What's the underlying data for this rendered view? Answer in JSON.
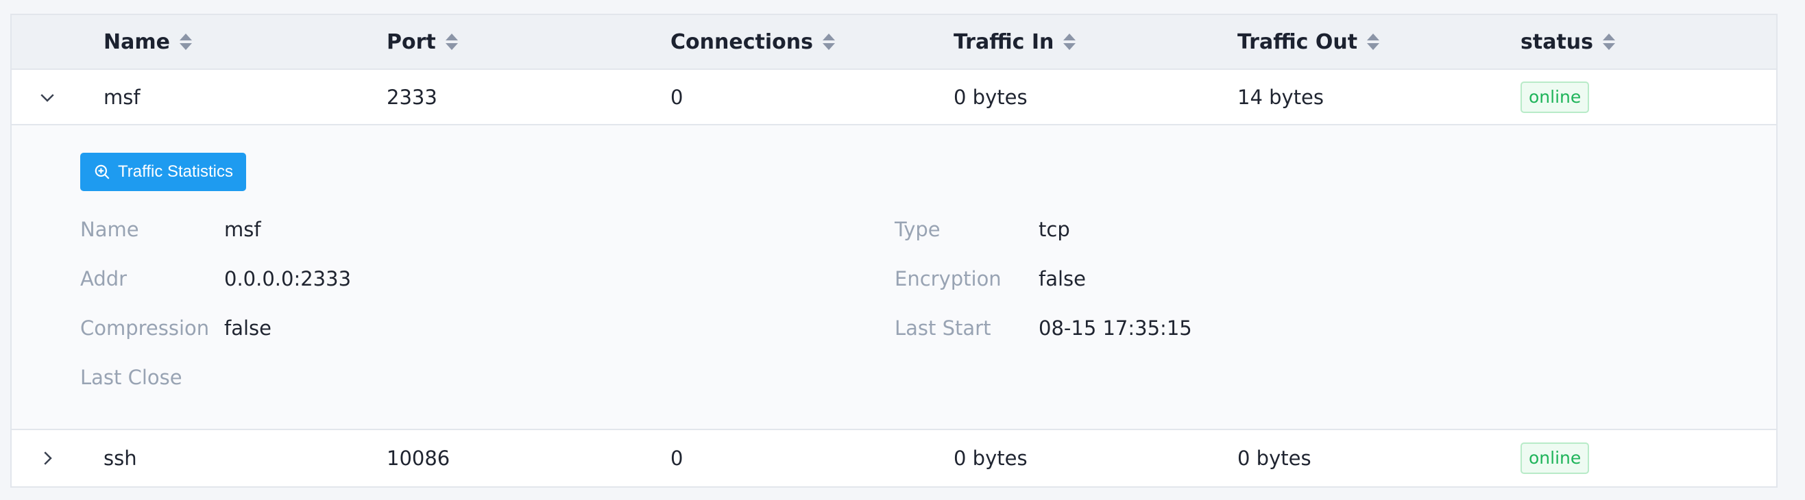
{
  "columns": [
    {
      "label": "Name"
    },
    {
      "label": "Port"
    },
    {
      "label": "Connections"
    },
    {
      "label": "Traffic In"
    },
    {
      "label": "Traffic Out"
    },
    {
      "label": "status"
    }
  ],
  "rows": [
    {
      "name": "msf",
      "port": "2333",
      "connections": "0",
      "traffic_in": "0 bytes",
      "traffic_out": "14 bytes",
      "status": "online",
      "expanded": true
    },
    {
      "name": "ssh",
      "port": "10086",
      "connections": "0",
      "traffic_in": "0 bytes",
      "traffic_out": "0 bytes",
      "status": "online",
      "expanded": false
    }
  ],
  "detail": {
    "button_label": "Traffic Statistics",
    "fields": [
      {
        "label": "Name",
        "value": "msf"
      },
      {
        "label": "Type",
        "value": "tcp"
      },
      {
        "label": "Addr",
        "value": "0.0.0.0:2333"
      },
      {
        "label": "Encryption",
        "value": "false"
      },
      {
        "label": "Compression",
        "value": "false"
      },
      {
        "label": "Last Start",
        "value": "08-15 17:35:15"
      },
      {
        "label": "Last Close",
        "value": ""
      }
    ]
  },
  "icons": {
    "expanded": "chevron-down-icon",
    "collapsed": "chevron-right-icon",
    "sort": "sort-icon",
    "zoom": "zoom-in-icon"
  },
  "colors": {
    "accent": "#1e9bf0",
    "status_online": "#1fb45a",
    "header_bg": "#eef1f5",
    "label_gray": "#98a3b3"
  }
}
